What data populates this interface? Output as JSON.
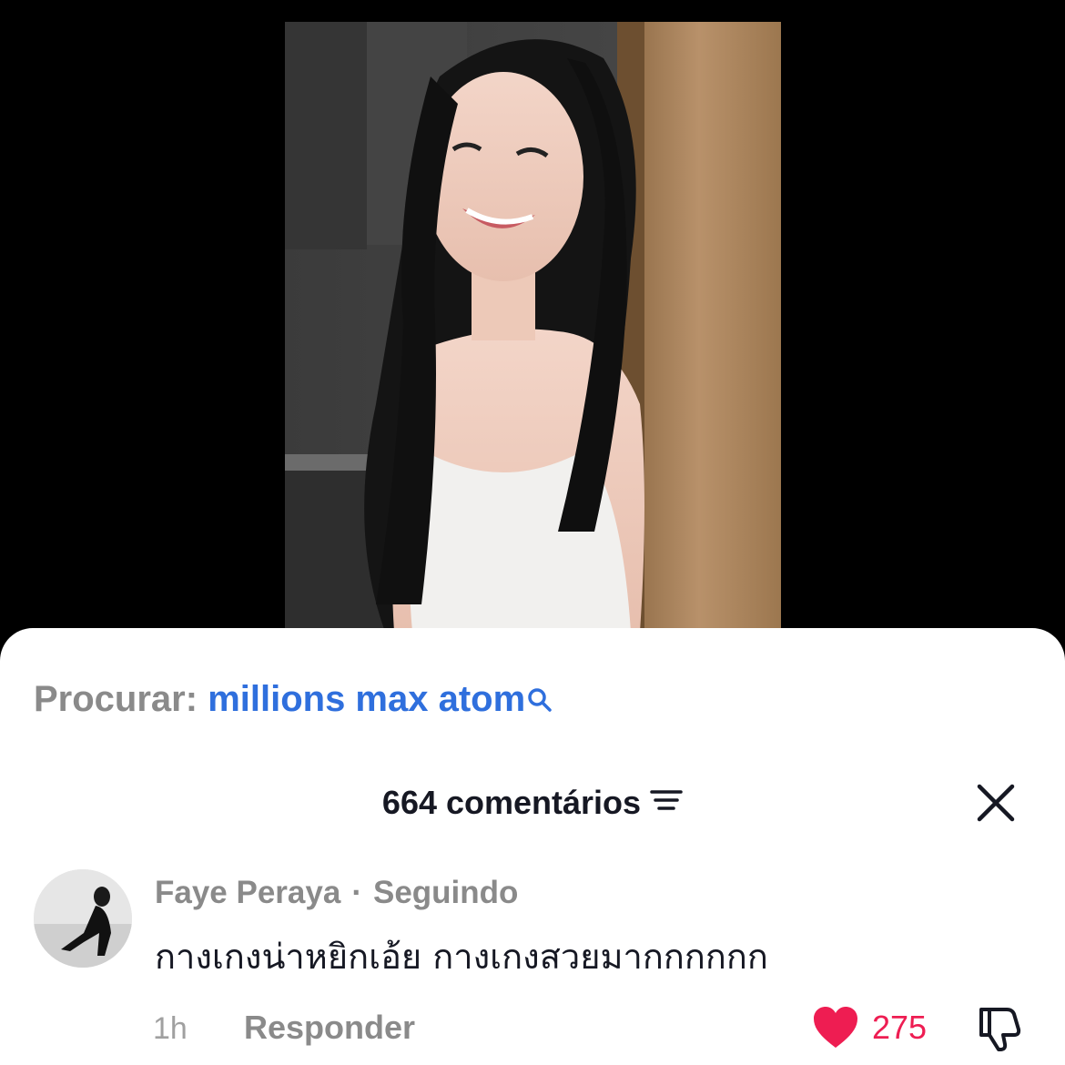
{
  "video": {
    "description_icon": "video-frame"
  },
  "search": {
    "prefix": "Procurar:",
    "term": "millions max atom",
    "icon": "search-icon"
  },
  "comments_header": {
    "count_label": "664 comentários",
    "sort_icon": "sort-icon",
    "close_icon": "close-icon"
  },
  "comment": {
    "author": "Faye Peraya",
    "separator": "·",
    "relation": "Seguindo",
    "text": "กางเกงน่าหยิกเอ้ย กางเกงสวยมากกกกกก",
    "time": "1h",
    "reply_label": "Responder",
    "likes": "275",
    "like_icon": "heart-icon",
    "dislike_icon": "thumbs-down-icon"
  },
  "colors": {
    "accent_blue": "#2f6fdd",
    "like_red": "#ee1d52",
    "muted_gray": "#8a8a8a",
    "text_dark": "#161823"
  }
}
